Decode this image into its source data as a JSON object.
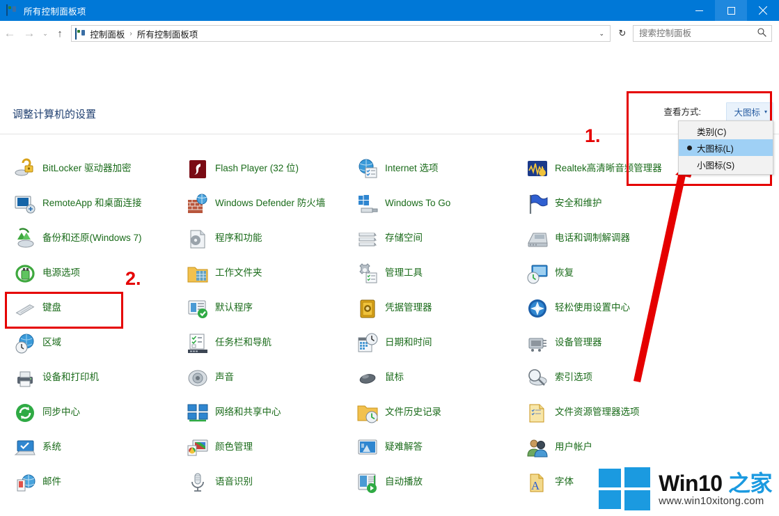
{
  "window": {
    "title": "所有控制面板项",
    "icon": "control-panel-icon",
    "buttons": {
      "minimize": "—",
      "maximize": "□",
      "close": "✕"
    }
  },
  "navbar": {
    "back": "←",
    "forward": "→",
    "recent": "⌄",
    "up": "↑",
    "breadcrumbs": [
      "控制面板",
      "所有控制面板项"
    ],
    "separator": "›",
    "dropdown_caret": "⌄",
    "refresh": "↻",
    "search": {
      "placeholder": "搜索控制面板",
      "value": "",
      "icon": "search-icon"
    }
  },
  "page": {
    "heading": "调整计算机的设置",
    "view_by_label": "查看方式:",
    "view_by_value": "大图标",
    "view_by_caret": "▾"
  },
  "view_menu": {
    "items": [
      {
        "label": "类别(C)",
        "selected": false
      },
      {
        "label": "大图标(L)",
        "selected": true
      },
      {
        "label": "小图标(S)",
        "selected": false
      }
    ]
  },
  "annotations": {
    "step1": "1.",
    "step2": "2.",
    "accent_color": "#e50000"
  },
  "watermark": {
    "brand_latin": "Win10 ",
    "brand_cn": "之家",
    "url": "www.win10xitong.com"
  },
  "items": [
    {
      "label": "BitLocker 驱动器加密",
      "icon": "bitlocker-icon",
      "col": 0,
      "row": 0
    },
    {
      "label": "RemoteApp 和桌面连接",
      "icon": "remoteapp-icon",
      "col": 0,
      "row": 1
    },
    {
      "label": "备份和还原(Windows 7)",
      "icon": "backup-restore-icon",
      "col": 0,
      "row": 2
    },
    {
      "label": "电源选项",
      "icon": "power-options-icon",
      "col": 0,
      "row": 3
    },
    {
      "label": "键盘",
      "icon": "keyboard-icon",
      "col": 0,
      "row": 4
    },
    {
      "label": "区域",
      "icon": "region-icon",
      "col": 0,
      "row": 5
    },
    {
      "label": "设备和打印机",
      "icon": "devices-printers-icon",
      "col": 0,
      "row": 6
    },
    {
      "label": "同步中心",
      "icon": "sync-center-icon",
      "col": 0,
      "row": 7
    },
    {
      "label": "系统",
      "icon": "system-icon",
      "col": 0,
      "row": 8
    },
    {
      "label": "邮件",
      "icon": "mail-icon",
      "col": 0,
      "row": 9
    },
    {
      "label": "Flash Player (32 位)",
      "icon": "flash-player-icon",
      "col": 1,
      "row": 0
    },
    {
      "label": "Windows Defender 防火墙",
      "icon": "firewall-icon",
      "col": 1,
      "row": 1
    },
    {
      "label": "程序和功能",
      "icon": "programs-features-icon",
      "col": 1,
      "row": 2
    },
    {
      "label": "工作文件夹",
      "icon": "work-folders-icon",
      "col": 1,
      "row": 3
    },
    {
      "label": "默认程序",
      "icon": "default-programs-icon",
      "col": 1,
      "row": 4
    },
    {
      "label": "任务栏和导航",
      "icon": "taskbar-nav-icon",
      "col": 1,
      "row": 5
    },
    {
      "label": "声音",
      "icon": "sound-icon",
      "col": 1,
      "row": 6
    },
    {
      "label": "网络和共享中心",
      "icon": "network-sharing-icon",
      "col": 1,
      "row": 7
    },
    {
      "label": "颜色管理",
      "icon": "color-management-icon",
      "col": 1,
      "row": 8
    },
    {
      "label": "语音识别",
      "icon": "speech-recognition-icon",
      "col": 1,
      "row": 9
    },
    {
      "label": "Internet 选项",
      "icon": "internet-options-icon",
      "col": 2,
      "row": 0
    },
    {
      "label": "Windows To Go",
      "icon": "windows-to-go-icon",
      "col": 2,
      "row": 1
    },
    {
      "label": "存储空间",
      "icon": "storage-spaces-icon",
      "col": 2,
      "row": 2
    },
    {
      "label": "管理工具",
      "icon": "admin-tools-icon",
      "col": 2,
      "row": 3
    },
    {
      "label": "凭据管理器",
      "icon": "credential-manager-icon",
      "col": 2,
      "row": 4
    },
    {
      "label": "日期和时间",
      "icon": "date-time-icon",
      "col": 2,
      "row": 5
    },
    {
      "label": "鼠标",
      "icon": "mouse-icon",
      "col": 2,
      "row": 6
    },
    {
      "label": "文件历史记录",
      "icon": "file-history-icon",
      "col": 2,
      "row": 7
    },
    {
      "label": "疑难解答",
      "icon": "troubleshooting-icon",
      "col": 2,
      "row": 8
    },
    {
      "label": "自动播放",
      "icon": "autoplay-icon",
      "col": 2,
      "row": 9
    },
    {
      "label": "Realtek高清晰音频管理器",
      "icon": "realtek-audio-icon",
      "col": 3,
      "row": 0
    },
    {
      "label": "安全和维护",
      "icon": "security-maintenance-icon",
      "col": 3,
      "row": 1
    },
    {
      "label": "电话和调制解调器",
      "icon": "phone-modem-icon",
      "col": 3,
      "row": 2
    },
    {
      "label": "恢复",
      "icon": "recovery-icon",
      "col": 3,
      "row": 3
    },
    {
      "label": "轻松使用设置中心",
      "icon": "ease-of-access-icon",
      "col": 3,
      "row": 4
    },
    {
      "label": "设备管理器",
      "icon": "device-manager-icon",
      "col": 3,
      "row": 5
    },
    {
      "label": "索引选项",
      "icon": "indexing-options-icon",
      "col": 3,
      "row": 6
    },
    {
      "label": "文件资源管理器选项",
      "icon": "file-explorer-options-icon",
      "col": 3,
      "row": 7
    },
    {
      "label": "用户帐户",
      "icon": "user-accounts-icon",
      "col": 3,
      "row": 8
    },
    {
      "label": "字体",
      "icon": "fonts-icon",
      "col": 3,
      "row": 9
    }
  ]
}
